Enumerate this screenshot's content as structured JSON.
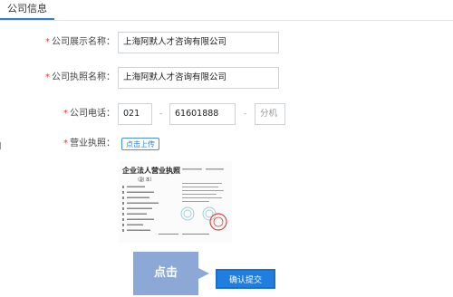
{
  "tabs": {
    "active": "公司信息"
  },
  "form": {
    "display_name": {
      "required": "*",
      "label": "公司展示名称：",
      "value": "上海阿默人才咨询有限公司"
    },
    "legal_name": {
      "required": "*",
      "label": "公司执照名称：",
      "value": "上海阿默人才咨询有限公司"
    },
    "phone": {
      "required": "*",
      "label": "公司电话：",
      "area_code": "021",
      "number": "61601888",
      "ext_placeholder": "分机",
      "separator": "-"
    },
    "license": {
      "required": "*",
      "label": "营业执照：",
      "upload_label": "点击上传"
    }
  },
  "license_image": {
    "title": "企业法人营业执照",
    "subtitle": "（副 本）"
  },
  "callout": {
    "text": "点击"
  },
  "actions": {
    "confirm_label": "确认提交"
  },
  "colors": {
    "accent": "#1f7fe0",
    "callout": "#8ba8d6",
    "required": "#e03a2f"
  }
}
